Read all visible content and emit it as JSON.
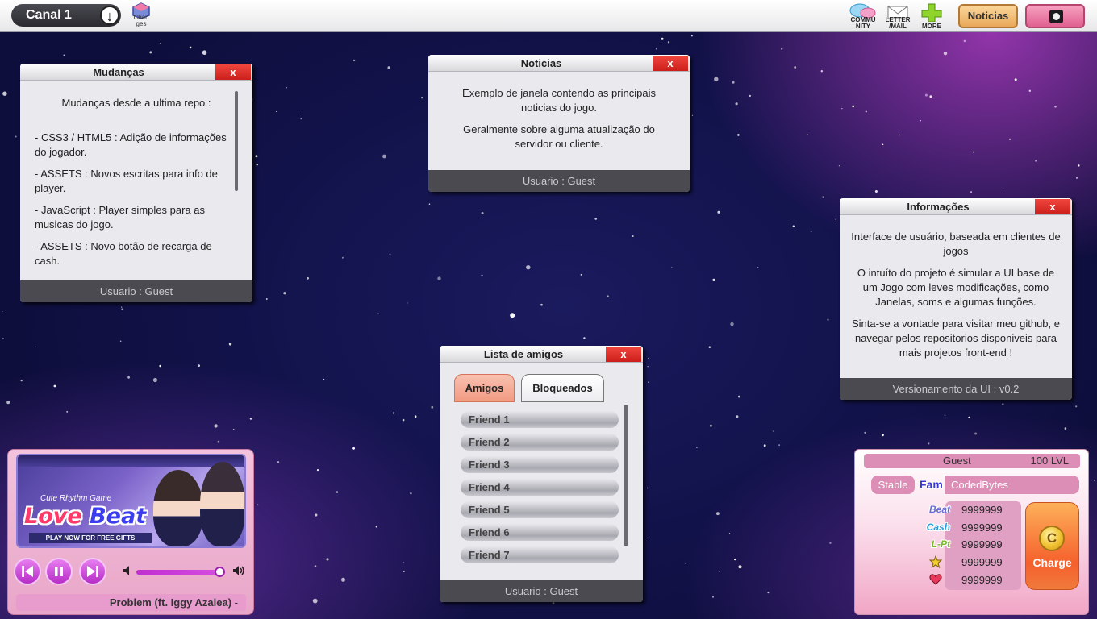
{
  "topbar": {
    "channel": "Canal 1",
    "changes_label": "Chan ges",
    "community_label": "COMMU NITY",
    "letter_label": "LETTER /MAIL",
    "more_label": "MORE",
    "news_button": "Noticias"
  },
  "windows": {
    "mudancas": {
      "title": "Mudanças",
      "close": "x",
      "heading": "Mudanças desde a ultima repo :",
      "items": [
        "- CSS3 / HTML5 : Adição de informações do jogador.",
        "- ASSETS : Novos escritas para info de player.",
        "- JavaScript : Player simples para as musicas do jogo.",
        "- ASSETS : Novo botão de recarga de cash."
      ],
      "footer": "Usuario : Guest"
    },
    "noticias": {
      "title": "Noticias",
      "close": "x",
      "p1": "Exemplo de janela contendo as principais noticias do jogo.",
      "p2": "Geralmente sobre alguma atualização do servidor ou cliente.",
      "footer": "Usuario : Guest"
    },
    "informacoes": {
      "title": "Informações",
      "close": "x",
      "p1": "Interface de usuário, baseada em clientes de jogos",
      "p2": "O intuíto do projeto é simular a UI base de um Jogo com leves modificações, como Janelas, soms e algumas funções.",
      "p3": "Sinta-se a vontade para visitar meu github, e navegar pelos repositorios disponiveis para mais projetos front-end !",
      "footer": "Versionamento da UI : v0.2"
    },
    "amigos": {
      "title": "Lista de amigos",
      "close": "x",
      "tab_active": "Amigos",
      "tab_inactive": "Bloqueados",
      "friends": [
        "Friend 1",
        "Friend 2",
        "Friend 3",
        "Friend 4",
        "Friend 5",
        "Friend 6",
        "Friend 7"
      ],
      "footer": "Usuario : Guest"
    }
  },
  "player": {
    "banner_sub": "Cute Rhythm Game",
    "banner_title_1": "Love",
    "banner_title_2": "Beat",
    "banner_cta": "PLAY NOW FOR FREE GIFTS",
    "volume": 1.0,
    "song": "Problem (ft. Iggy Azalea) -"
  },
  "card": {
    "name": "Guest",
    "level": "100 LVL",
    "status": "Stable",
    "fam_label": "Fam",
    "fam_value": "CodedBytes",
    "stats": [
      {
        "label": "Beat",
        "value": "9999999",
        "color": "#6a6ad8"
      },
      {
        "label": "Cash",
        "value": "9999999",
        "color": "#2a9bd8"
      },
      {
        "label": "L-Pt",
        "value": "9999999",
        "color": "#7ab82a"
      },
      {
        "label": "",
        "icon": "star-icon",
        "value": "9999999",
        "color": "#e9c12a"
      },
      {
        "label": "",
        "icon": "heart-icon",
        "value": "9999999",
        "color": "#e23a5a"
      }
    ],
    "charge_coin": "C",
    "charge_label": "Charge"
  }
}
